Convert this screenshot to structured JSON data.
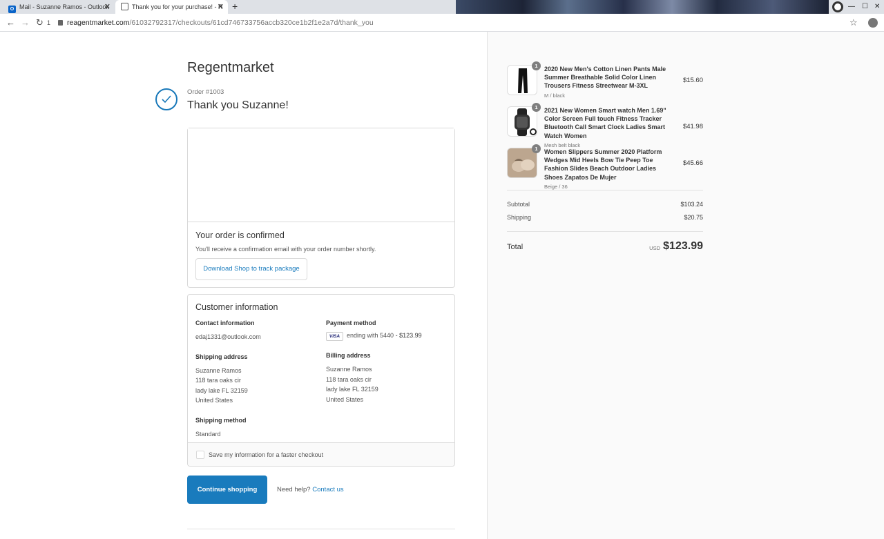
{
  "browser": {
    "tabs": [
      {
        "title": "Mail - Suzanne Ramos - Outlook",
        "icon": "outlook-icon"
      },
      {
        "title": "Thank you for your purchase! - R",
        "icon": "globe-icon"
      }
    ],
    "close_glyph": "✕",
    "new_tab_glyph": "+",
    "url_host": "reagentmarket.com",
    "url_path": "/61032792317/checkouts/61cd746733756accb320ce1b2f1e2a7d/thank_you",
    "back_glyph": "←",
    "forward_glyph": "→",
    "reload_glyph": "↻",
    "badge": "1",
    "star_glyph": "☆"
  },
  "page": {
    "store_name": "Regentmarket",
    "order_number": "Order #1003",
    "thank_you": "Thank you Suzanne!",
    "confirmed_title": "Your order is confirmed",
    "confirmed_text": "You'll receive a confirmation email with your order number shortly.",
    "shop_button": "Download Shop to track package",
    "customer_title": "Customer information",
    "contact_label": "Contact information",
    "contact_email": "edaj1331@outlook.com",
    "payment_label": "Payment method",
    "card_brand": "VISA",
    "payment_ending": "ending with 5440",
    "payment_amount": "- $123.99",
    "shipping_address_label": "Shipping address",
    "shipping_address": [
      "Suzanne Ramos",
      "118 tara oaks cir",
      "lady lake FL 32159",
      "United States"
    ],
    "billing_address_label": "Billing address",
    "billing_address": [
      "Suzanne Ramos",
      "118 tara oaks cir",
      "lady lake FL 32159",
      "United States"
    ],
    "shipping_method_label": "Shipping method",
    "shipping_method": "Standard",
    "save_info_label": "Save my information for a faster checkout",
    "continue_button": "Continue shopping",
    "help_text": "Need help?",
    "contact_link": "Contact us"
  },
  "order_summary": {
    "items": [
      {
        "name": "2020 New Men's Cotton Linen Pants Male Summer Breathable Solid Color Linen Trousers Fitness Streetwear M-3XL",
        "variant": "M / black",
        "price": "$15.60",
        "qty": "1"
      },
      {
        "name": "2021 New Women Smart watch Men 1.69\" Color Screen Full touch Fitness Tracker Bluetooth Call Smart Clock Ladies Smart Watch Women",
        "variant": "Mesh belt black",
        "price": "$41.98",
        "qty": "1"
      },
      {
        "name": "Women Slippers Summer 2020 Platform Wedges Mid Heels Bow Tie Peep Toe Fashion Slides Beach Outdoor Ladies Shoes Zapatos De Mujer",
        "variant": "Beige / 36",
        "price": "$45.66",
        "qty": "1"
      }
    ],
    "subtotal_label": "Subtotal",
    "subtotal": "$103.24",
    "shipping_label": "Shipping",
    "shipping": "$20.75",
    "total_label": "Total",
    "currency": "USD",
    "total": "$123.99"
  },
  "colors": {
    "accent": "#197bbd",
    "sidebar_bg": "#fafafa",
    "border": "#d9d9d9"
  }
}
